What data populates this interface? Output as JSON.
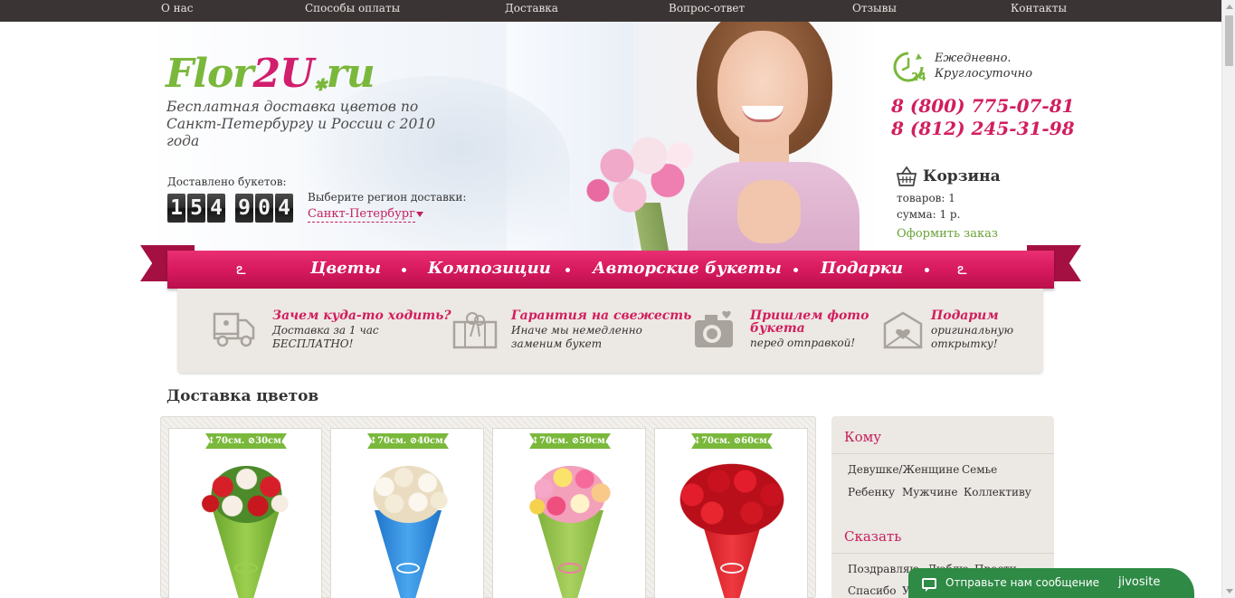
{
  "topnav": [
    "О нас",
    "Способы оплаты",
    "Доставка",
    "Вопрос-ответ",
    "Отзывы",
    "Контакты"
  ],
  "logo": {
    "part1": "Flor",
    "part2": "2U",
    "part3": "ru"
  },
  "tagline": "Бесплатная доставка цветов по Санкт-Петербургу и России с 2010 года",
  "delivered": {
    "label": "Доставлено букетов:",
    "digits1": [
      "1",
      "5",
      "4"
    ],
    "digits2": [
      "9",
      "0",
      "4"
    ]
  },
  "region": {
    "label": "Выберите регион доставки:",
    "value": "Санкт-Петербург"
  },
  "hours": {
    "line1": "Ежедневно.",
    "line2": "Круглосуточно"
  },
  "phones": [
    "8 (800) 775-07-81",
    "8 (812) 245-31-98"
  ],
  "cart": {
    "title": "Корзина",
    "items": "товаров: 1",
    "sum": "сумма: 1 р.",
    "checkout": "Оформить заказ"
  },
  "menu": [
    "Цветы",
    "Композиции",
    "Авторские букеты",
    "Подарки"
  ],
  "features": [
    {
      "title": "Зачем куда-то ходить?",
      "text1": "Доставка за 1 час",
      "text2": "БЕСПЛАТНО!"
    },
    {
      "title": "Гарантия на свежесть",
      "text1": "Иначе мы немедленно",
      "text2": "заменим букет"
    },
    {
      "title1": "Пришлем фото",
      "title2": "букета",
      "text1": "перед отправкой!"
    },
    {
      "title": "Подарим",
      "text1": "оригинальную",
      "text2": "открытку!"
    }
  ],
  "section_title": "Доставка цветов",
  "products": [
    {
      "height": "70см.",
      "diameter": "30см."
    },
    {
      "height": "70см.",
      "diameter": "40см."
    },
    {
      "height": "70см.",
      "diameter": "50см."
    },
    {
      "height": "70см.",
      "diameter": "60см."
    }
  ],
  "sidebar": {
    "whom_title": "Кому",
    "whom": [
      "Девушке/Женщине",
      "Семье",
      "Ребенку",
      "Мужчине",
      "Коллективу"
    ],
    "say_title": "Сказать",
    "say": [
      "Поздравляю",
      "Люблю",
      "Прости",
      "Спасибо",
      "У"
    ]
  },
  "chat": {
    "text": "Отправьте нам сообщение",
    "brand": "jivosite"
  },
  "colors": {
    "accent": "#d11e5f",
    "green": "#7ab83c",
    "topnav": "#3a3534"
  }
}
